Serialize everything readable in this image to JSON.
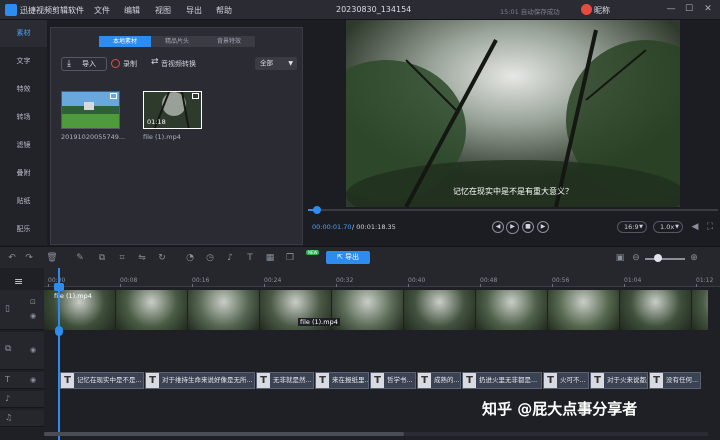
{
  "app": {
    "title": "迅捷视频剪辑软件",
    "menu": [
      "文件",
      "编辑",
      "视图",
      "导出",
      "帮助"
    ],
    "project_title": "20230830_134154",
    "save_status": "15:01 自动保存成功",
    "user_name": "昵称",
    "window_controls": [
      "minimize-icon",
      "maximize-icon",
      "close-icon"
    ]
  },
  "sidebar": {
    "items": [
      {
        "label": "素材",
        "active": true
      },
      {
        "label": "文字"
      },
      {
        "label": "特效"
      },
      {
        "label": "转场"
      },
      {
        "label": "滤镜"
      },
      {
        "label": "叠附"
      },
      {
        "label": "贴纸"
      },
      {
        "label": "配乐"
      }
    ]
  },
  "media": {
    "tabs": [
      "本地素材",
      "精品片头",
      "背景特效"
    ],
    "import_label": "导入",
    "record_label": "录制",
    "convert_label": "音视频转换",
    "filter_value": "全部",
    "items": [
      {
        "name": "20191020055749...",
        "duration": ""
      },
      {
        "name": "file (1).mp4",
        "duration": "01:18"
      }
    ]
  },
  "preview": {
    "subtitle": "记忆在现实中是不是有重大意义？",
    "current_time": "00:00:01.70",
    "total_time": "/ 00:01:18.35",
    "progress": 0.02,
    "aspect": "16:9",
    "speed": "1.0x"
  },
  "toolbar": {
    "export_label": "导出",
    "badge": "NEW"
  },
  "timeline": {
    "ticks": [
      "00:00",
      "00:08",
      "00:16",
      "00:24",
      "00:32",
      "00:40",
      "00:48",
      "00:56",
      "01:04",
      "01:12"
    ],
    "video_clip_top_label": "file (1).mp4",
    "video_clip_mid_label": "file (1).mp4",
    "subtitle_clips": [
      "记忆在现实中是不是...",
      "对于维持生命来说好像是无所...",
      "无非就是然...",
      "来在报纸里...",
      "哲学书...",
      "成熟的...",
      "扔进火里无非都是...",
      "火可不...",
      "对于火来说都是...",
      "没有任何..."
    ],
    "watermark": "知乎 @屁大点事分享者"
  }
}
